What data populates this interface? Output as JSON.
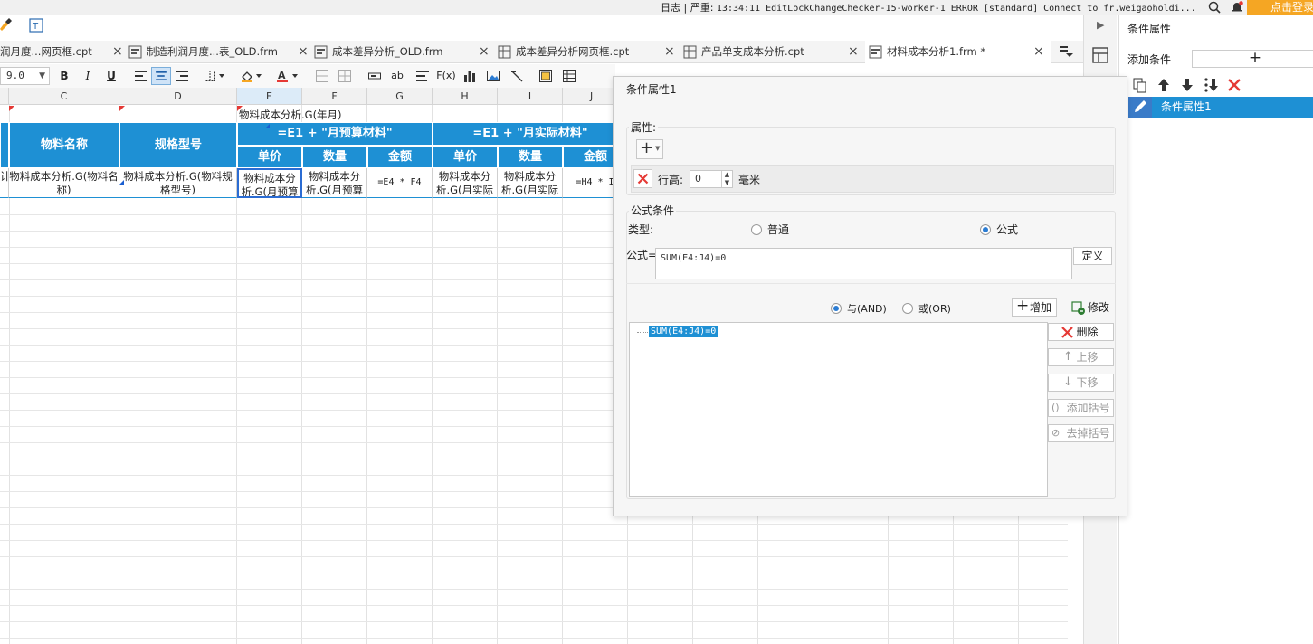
{
  "topbar": {
    "status_prefix": "日志 | 严重:",
    "status_msg": "13:34:11 EditLockChangeChecker-15-worker-1 ERROR [standard] Connect to fr.weigaoholdi...",
    "login_label": "点击登录"
  },
  "tabs": [
    {
      "label": "润月度...网页框.cpt",
      "close": "×"
    },
    {
      "label": "制造利润月度...表_OLD.frm",
      "close": "×"
    },
    {
      "label": "成本差异分析_OLD.frm",
      "close": "×"
    },
    {
      "label": "成本差异分析网页框.cpt",
      "close": "×"
    },
    {
      "label": "产品单支成本分析.cpt",
      "close": "×"
    },
    {
      "label": "材料成本分析1.frm *",
      "close": "×"
    }
  ],
  "toolbar": {
    "font_size": "9.0",
    "bold": "B",
    "italic": "I",
    "underline": "U",
    "text_ab": "ab",
    "fx": "F(x)"
  },
  "sheet": {
    "columns": [
      "C",
      "D",
      "E",
      "F",
      "G",
      "H",
      "I",
      "J"
    ],
    "title_cell": "物料成本分析.G(年月)",
    "header": {
      "material_name": "物料名称",
      "spec_model": "规格型号",
      "budget_group": "=E1 + \"月预算材料\"",
      "actual_group": "=E1 + \"月实际材料\"",
      "unit_price": "单价",
      "quantity": "数量",
      "amount": "金额"
    },
    "data_row": {
      "b": "计",
      "c": "物料成本分析.G(物料名称)",
      "d": "物料成本分析.G(物料规格型号)",
      "e": "物料成本分析.G(月预算",
      "f": "物料成本分析.G(月预算",
      "g": "=E4 * F4",
      "h": "物料成本分析.G(月实际",
      "i": "物料成本分析.G(月实际",
      "j": "=H4 * I"
    }
  },
  "right_panel": {
    "title": "条件属性",
    "add_label": "添加条件",
    "add_button": "+",
    "list_item": "条件属性1"
  },
  "dialog": {
    "title": "条件属性1",
    "attr_group": "属性:",
    "row_height_label": "行高:",
    "row_height_value": "0",
    "row_height_unit": "毫米",
    "formula_group": "公式条件",
    "type_label": "类型:",
    "type_normal": "普通",
    "type_formula": "公式",
    "formula_label": "公式=",
    "formula_value": "SUM(E4:J4)=0",
    "define_btn": "定义",
    "and_label": "与(AND)",
    "or_label": "或(OR)",
    "add_btn": "增加",
    "modify_btn": "修改",
    "cond_item": "SUM(E4:J4)=0",
    "delete_btn": "删除",
    "up_btn": "上移",
    "down_btn": "下移",
    "add_paren_btn": "添加括号",
    "remove_paren_btn": "去掉括号"
  },
  "colors": {
    "accent": "#1e90d4",
    "login_bg": "#f5a623",
    "danger": "#e53935"
  }
}
